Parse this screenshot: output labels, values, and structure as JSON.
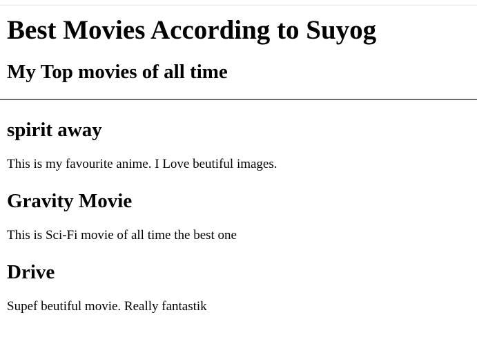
{
  "header": {
    "title": "Best Movies According to Suyog",
    "subtitle": "My Top movies of all time"
  },
  "movies": [
    {
      "title": "spirit away",
      "description": "This is my favourite anime. I Love beutiful images."
    },
    {
      "title": "Gravity Movie",
      "description": "This is Sci-Fi movie of all time the best one"
    },
    {
      "title": "Drive",
      "description": "Supef beutiful movie. Really fantastik"
    }
  ]
}
